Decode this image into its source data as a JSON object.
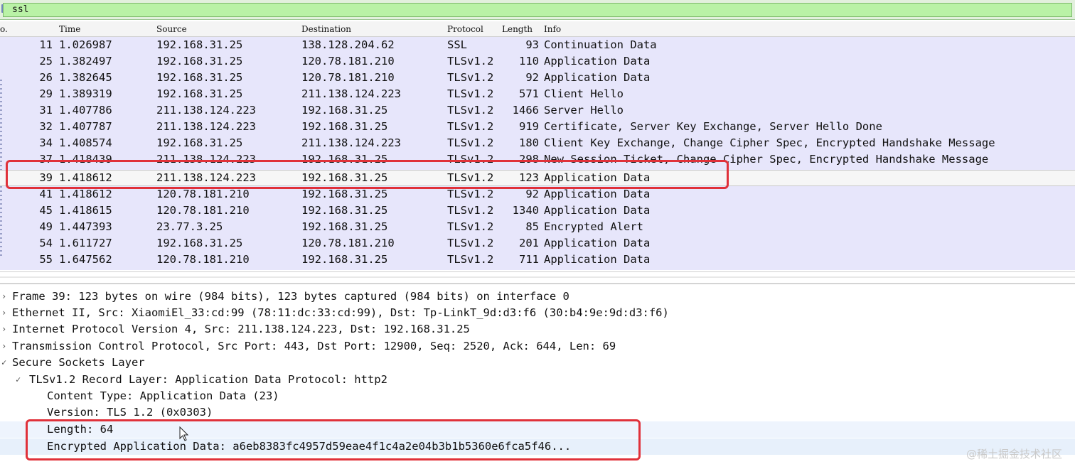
{
  "filter": {
    "value": "ssl"
  },
  "columns": [
    "o.",
    "Time",
    "Source",
    "Destination",
    "Protocol",
    "Length",
    "Info"
  ],
  "packets": [
    {
      "no": "11",
      "time": "1.026987",
      "src": "192.168.31.25",
      "dst": "138.128.204.62",
      "proto": "SSL",
      "len": "93",
      "info": "Continuation Data"
    },
    {
      "no": "25",
      "time": "1.382497",
      "src": "192.168.31.25",
      "dst": "120.78.181.210",
      "proto": "TLSv1.2",
      "len": "110",
      "info": "Application Data"
    },
    {
      "no": "26",
      "time": "1.382645",
      "src": "192.168.31.25",
      "dst": "120.78.181.210",
      "proto": "TLSv1.2",
      "len": "92",
      "info": "Application Data"
    },
    {
      "no": "29",
      "time": "1.389319",
      "src": "192.168.31.25",
      "dst": "211.138.124.223",
      "proto": "TLSv1.2",
      "len": "571",
      "info": "Client Hello"
    },
    {
      "no": "31",
      "time": "1.407786",
      "src": "211.138.124.223",
      "dst": "192.168.31.25",
      "proto": "TLSv1.2",
      "len": "1466",
      "info": "Server Hello"
    },
    {
      "no": "32",
      "time": "1.407787",
      "src": "211.138.124.223",
      "dst": "192.168.31.25",
      "proto": "TLSv1.2",
      "len": "919",
      "info": "Certificate, Server Key Exchange, Server Hello Done"
    },
    {
      "no": "34",
      "time": "1.408574",
      "src": "192.168.31.25",
      "dst": "211.138.124.223",
      "proto": "TLSv1.2",
      "len": "180",
      "info": "Client Key Exchange, Change Cipher Spec, Encrypted Handshake Message"
    },
    {
      "no": "37",
      "time": "1.418439",
      "src": "211.138.124.223",
      "dst": "192.168.31.25",
      "proto": "TLSv1.2",
      "len": "298",
      "info": "New Session Ticket, Change Cipher Spec, Encrypted Handshake Message"
    },
    {
      "no": "39",
      "time": "1.418612",
      "src": "211.138.124.223",
      "dst": "192.168.31.25",
      "proto": "TLSv1.2",
      "len": "123",
      "info": "Application Data"
    },
    {
      "no": "41",
      "time": "1.418612",
      "src": "120.78.181.210",
      "dst": "192.168.31.25",
      "proto": "TLSv1.2",
      "len": "92",
      "info": "Application Data"
    },
    {
      "no": "45",
      "time": "1.418615",
      "src": "120.78.181.210",
      "dst": "192.168.31.25",
      "proto": "TLSv1.2",
      "len": "1340",
      "info": "Application Data"
    },
    {
      "no": "49",
      "time": "1.447393",
      "src": "23.77.3.25",
      "dst": "192.168.31.25",
      "proto": "TLSv1.2",
      "len": "85",
      "info": "Encrypted Alert"
    },
    {
      "no": "54",
      "time": "1.611727",
      "src": "192.168.31.25",
      "dst": "120.78.181.210",
      "proto": "TLSv1.2",
      "len": "201",
      "info": "Application Data"
    },
    {
      "no": "55",
      "time": "1.647562",
      "src": "120.78.181.210",
      "dst": "192.168.31.25",
      "proto": "TLSv1.2",
      "len": "711",
      "info": "Application Data"
    }
  ],
  "details": [
    {
      "arrow": "›",
      "text": "Frame 39: 123 bytes on wire (984 bits), 123 bytes captured (984 bits) on interface 0"
    },
    {
      "arrow": "›",
      "text": "Ethernet II, Src: XiaomiEl_33:cd:99 (78:11:dc:33:cd:99), Dst: Tp-LinkT_9d:d3:f6 (30:b4:9e:9d:d3:f6)"
    },
    {
      "arrow": "›",
      "text": "Internet Protocol Version 4, Src: 211.138.124.223, Dst: 192.168.31.25"
    },
    {
      "arrow": "›",
      "text": "Transmission Control Protocol, Src Port: 443, Dst Port: 12900, Seq: 2520, Ack: 644, Len: 69"
    },
    {
      "arrow": "✓",
      "text": "Secure Sockets Layer"
    },
    {
      "arrow": "✓",
      "text": "TLSv1.2 Record Layer: Application Data Protocol: http2"
    },
    {
      "arrow": "",
      "text": "Content Type: Application Data (23)"
    },
    {
      "arrow": "",
      "text": "Version: TLS 1.2 (0x0303)"
    },
    {
      "arrow": "",
      "text": "Length: 64"
    },
    {
      "arrow": "",
      "text": "Encrypted Application Data: a6eb8383fc4957d59eae4f1c4a2e04b3b1b5360e6fca5f46..."
    }
  ],
  "watermark": "@稀土掘金技术社区",
  "colors": {
    "filter_bg": "#b9f2a6",
    "list_bg": "#e7e6fb",
    "highlight_box": "#e0313a"
  }
}
